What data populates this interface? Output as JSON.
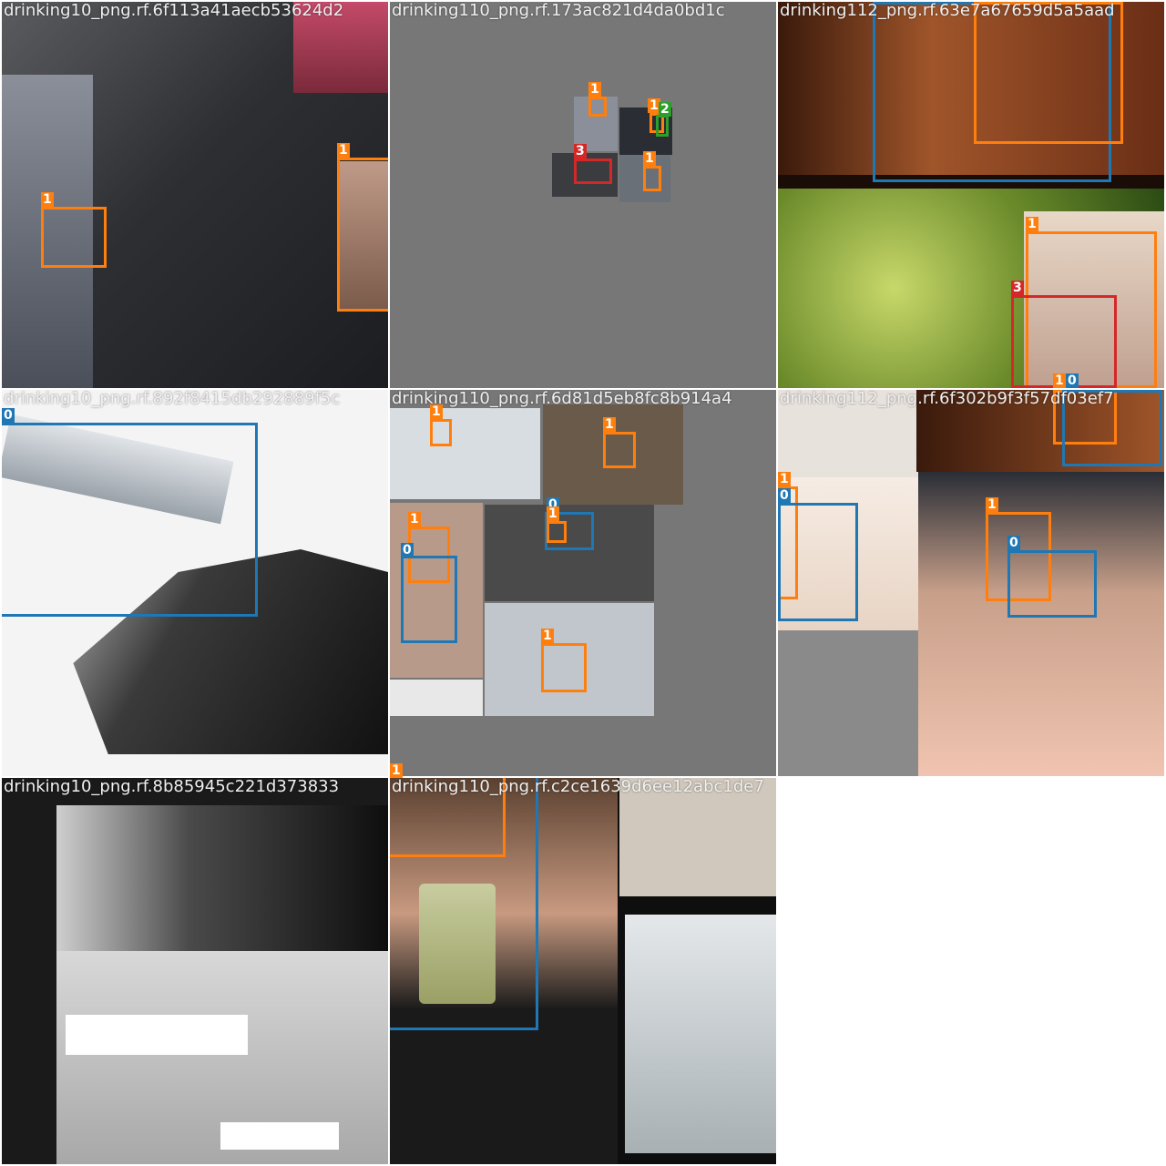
{
  "colors": {
    "class_0": "#1f77b4",
    "class_1": "#ff7f0e",
    "class_2": "#2ca02c",
    "class_3": "#d62728",
    "padding_gray": "#777777"
  },
  "tiles": [
    {
      "title": "drinking10_png.rf.6f113a41aecb53624d2",
      "labels": [
        "1",
        "1"
      ]
    },
    {
      "title": "drinking110_png.rf.173ac821d4da0bd1c",
      "labels": [
        "1",
        "1",
        "2",
        "3",
        "1"
      ]
    },
    {
      "title": "drinking112_png.rf.63e7a67659d5a5aad",
      "labels": [
        "1",
        "3",
        "1",
        "0"
      ]
    },
    {
      "title": "drinking10_png.rf.892f8415db292889f5c",
      "labels": [
        "0"
      ]
    },
    {
      "title": "drinking110_png.rf.6d81d5eb8fc8b914a4",
      "labels": [
        "1",
        "1",
        "0",
        "1",
        "1",
        "0",
        "1"
      ]
    },
    {
      "title": "drinking112_png.rf.6f302b9f3f57df03ef7",
      "labels": [
        "1",
        "0",
        "1",
        "0"
      ]
    },
    {
      "title": "drinking10_png.rf.8b85945c221d373833",
      "labels": []
    },
    {
      "title": "drinking110_png.rf.c2ce1639d6ee12abc1de7",
      "labels": [
        "1"
      ]
    }
  ]
}
